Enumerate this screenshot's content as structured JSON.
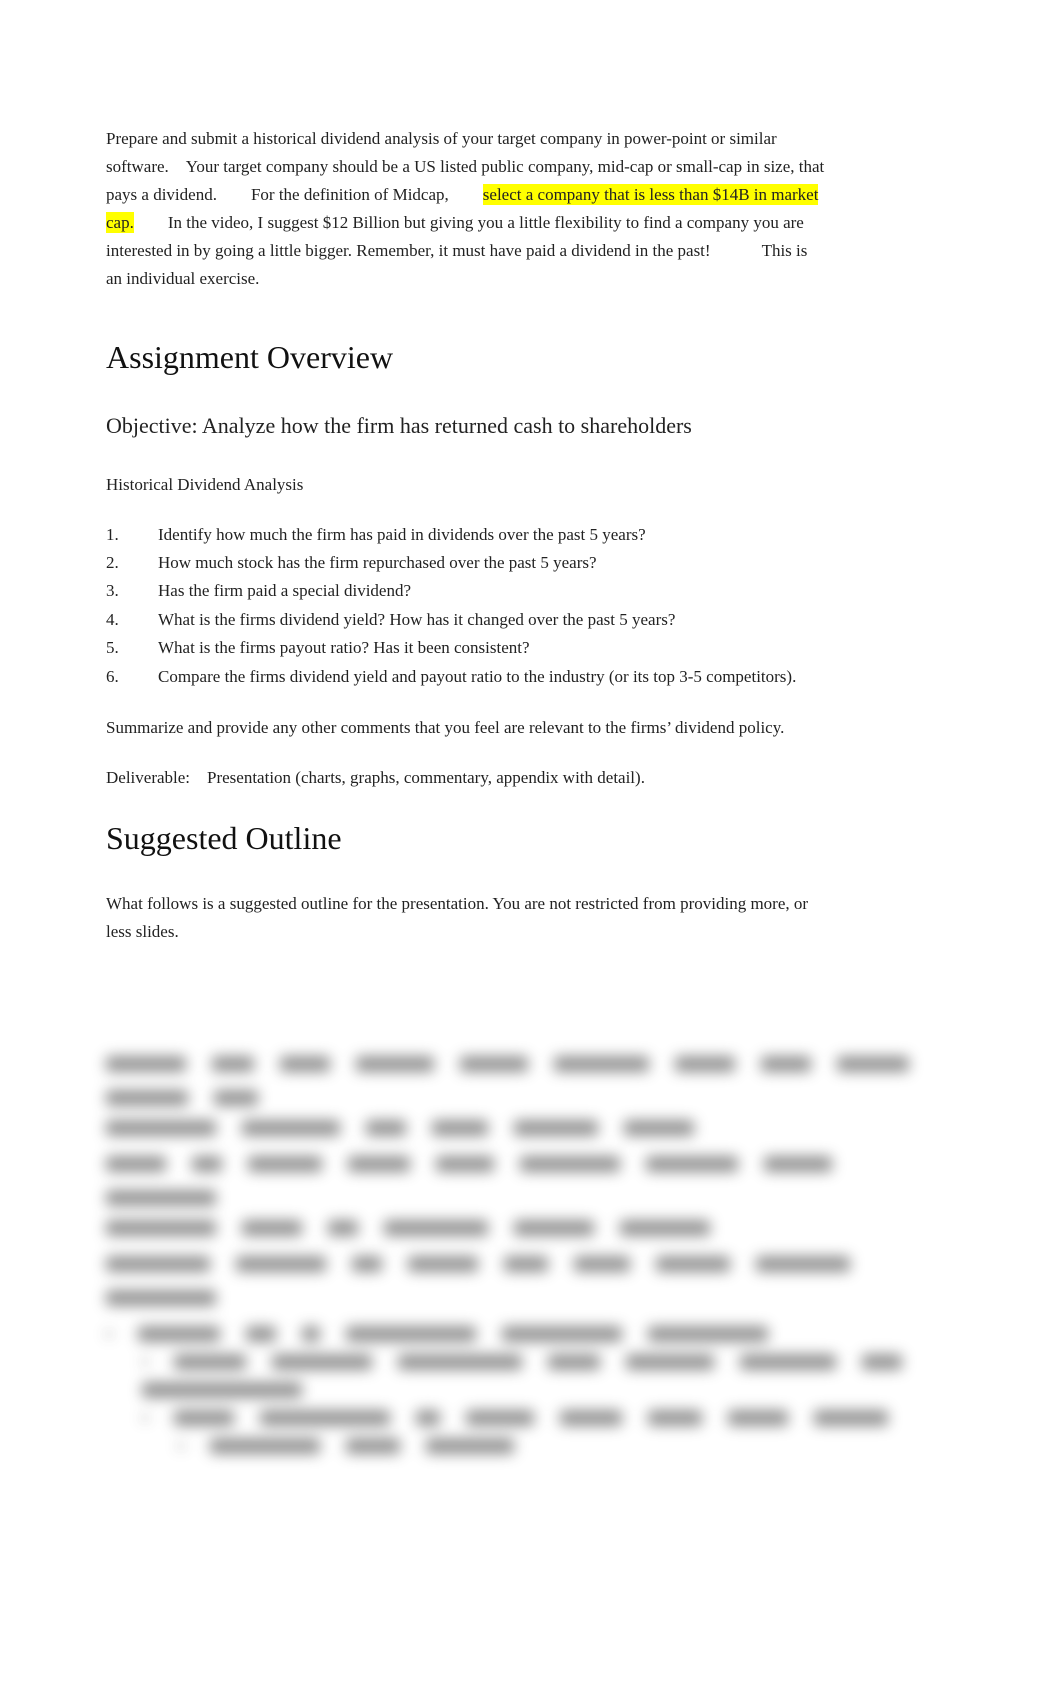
{
  "intro": {
    "text_before_highlight": "Prepare and submit a historical dividend analysis of your target company in power-point or similar software. Your target company should be a US listed public company, mid-cap or small-cap in size, that pays a dividend.  For the definition of Midcap,  ",
    "highlighted": "select a company that is less than $14B in market cap.",
    "text_after_highlight": "  In the video, I suggest $12 Billion but giving you a little flexibility to find a company you are interested in by going a little bigger. Remember, it must have paid a dividend in the past!   This is an individual exercise."
  },
  "section1": {
    "heading": "Assignment Overview",
    "objective": "Objective: Analyze how the firm has returned cash to shareholders",
    "subhead": "Historical Dividend Analysis",
    "questions": [
      "Identify how much the firm has paid in dividends over the past 5 years?",
      "How much stock has the firm repurchased over the past 5 years?",
      "Has the firm paid a special dividend?",
      "What is the firms dividend yield? How has it changed over the past 5 years?",
      "What is the firms payout ratio? Has it been consistent?",
      "Compare the firms dividend yield and payout ratio to the industry (or its top 3-5 competitors)."
    ],
    "summary": "Summarize and provide any other comments that you feel are relevant to the firms’ dividend policy.",
    "deliverable": "Deliverable: Presentation (charts, graphs, commentary, appendix with detail)."
  },
  "section2": {
    "heading": "Suggested Outline",
    "intro": "What follows is a suggested outline for the presentation. You are not restricted from providing more, or less slides."
  }
}
